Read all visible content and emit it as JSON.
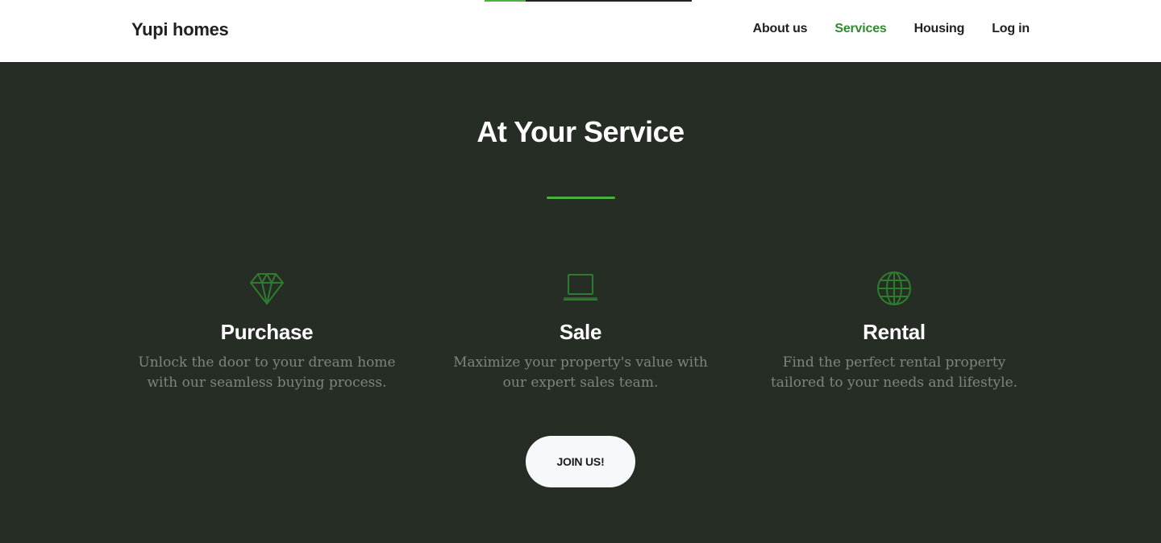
{
  "scroll_progress": {
    "percent": 20
  },
  "header": {
    "brand": "Yupi homes",
    "nav": [
      {
        "label": "About us",
        "active": false
      },
      {
        "label": "Services",
        "active": true
      },
      {
        "label": "Housing",
        "active": false
      },
      {
        "label": "Log in",
        "active": false
      }
    ]
  },
  "services": {
    "title": "At Your Service",
    "items": [
      {
        "icon": "diamond-icon",
        "name": "Purchase",
        "description": "Unlock the door to your dream home with our seamless buying process."
      },
      {
        "icon": "laptop-icon",
        "name": "Sale",
        "description": "Maximize your property's value with our expert sales team."
      },
      {
        "icon": "globe-icon",
        "name": "Rental",
        "description": "Find the perfect rental property tailored to your needs and lifestyle."
      }
    ],
    "cta_label": "JOIN US!"
  },
  "colors": {
    "accent": "#2e8b2e",
    "divider": "#4caf3f",
    "section_background": "#252d25",
    "header_background": "#ffffff"
  }
}
